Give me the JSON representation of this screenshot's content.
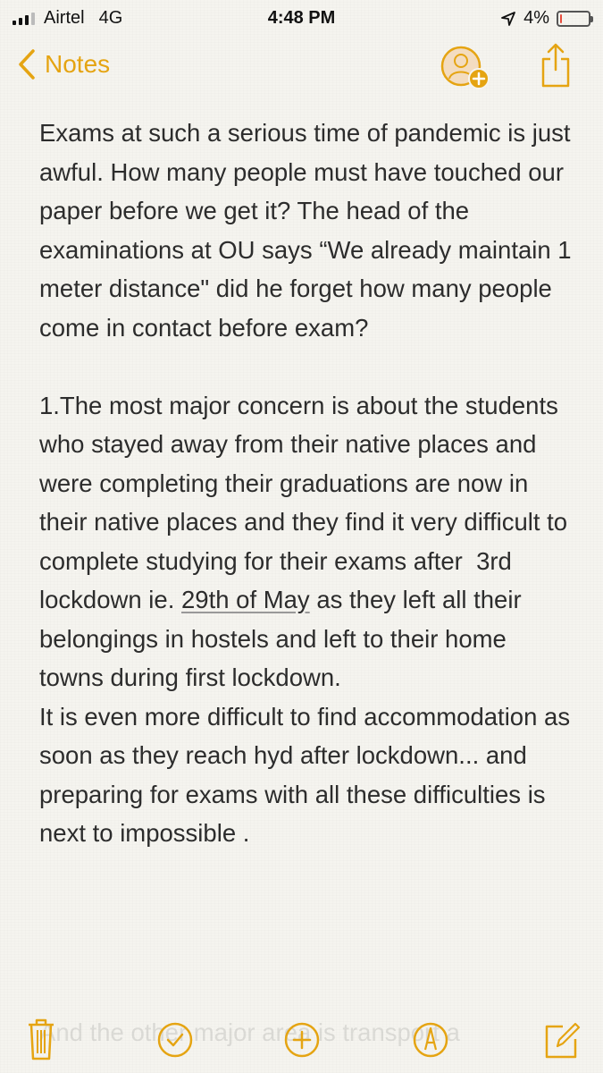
{
  "status": {
    "carrier": "Airtel",
    "network": "4G",
    "time": "4:48 PM",
    "battery": "4%",
    "battery_level": 0.04,
    "signal_bars": 3,
    "battery_color": "#e74c3c"
  },
  "nav": {
    "back_label": "Notes",
    "accent": "#e5a412"
  },
  "note": {
    "para1": "Exams at such a serious time of pandemic is just awful. How many people must have touched our paper before we get it? The head of the examinations at OU says “We already maintain 1 meter distance\" did he forget how many people come in contact before exam?",
    "para2_before": "1.The most major concern is about the students who stayed away from their native places and were completing their graduations are now in their native places and they find it very difficult to complete studying for their exams after  3rd lockdown ie. ",
    "para2_link": "29th of May",
    "para2_after": " as they left all their belongings in hostels and left to their home towns during first lockdown.",
    "para3": "It is even more difficult to find accommodation as soon as they reach hyd after lockdown... and preparing for exams with all these difficulties is next to impossible .",
    "faded_line": "And the other major area is transport a"
  },
  "toolbar": {
    "icons": [
      "trash-icon",
      "checklist-icon",
      "add-icon",
      "markup-icon",
      "compose-icon"
    ]
  }
}
